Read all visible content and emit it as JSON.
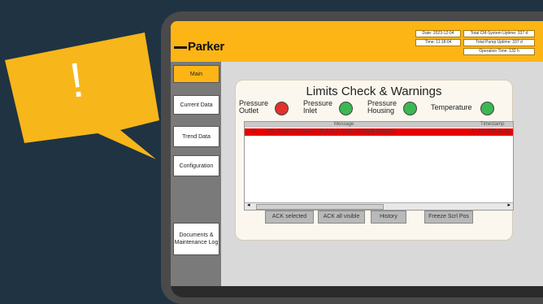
{
  "header": {
    "logo": "Parker",
    "date": "Date: 2023-12-04",
    "time": "Time: 11:18:04",
    "system_uptime": "Total CM-System Uptime: 337 d",
    "pump_uptime": "Total Pump Uptime: 337 d",
    "operation_time": "Operation Time: 132 h"
  },
  "sidebar": {
    "items": [
      {
        "label": "Main",
        "active": true
      },
      {
        "label": "Current Data"
      },
      {
        "label": "Trend Data"
      },
      {
        "label": "Configuration"
      },
      {
        "label": "Documents & Maintenance Log"
      }
    ]
  },
  "main": {
    "title": "Limits Check & Warnings",
    "sensors": [
      {
        "label_line1": "Pressure",
        "label_line2": "Outlet",
        "status_color": "#e0322b"
      },
      {
        "label_line1": "Pressure",
        "label_line2": "Inlet",
        "status_color": "#3cb754"
      },
      {
        "label_line1": "Pressure",
        "label_line2": "Housing",
        "status_color": "#3cb754"
      },
      {
        "label_line1": "Temperature",
        "label_line2": "",
        "status_color": "#3cb754"
      }
    ],
    "table": {
      "columns": [
        "",
        "Message",
        "Timestamp"
      ],
      "rows": [
        {
          "id": "0",
          "message": "The Outlet Pressure ( 0.65 bar) is below minimum pressure",
          "timestamp": "04.12.2023 11:18"
        }
      ]
    },
    "buttons": [
      "ACK selected",
      "ACK all visible",
      "History",
      "Freeze Scrl Pos"
    ]
  },
  "alert_symbol": "!",
  "colors": {
    "brand": "#fdb515",
    "alarm_row": "#e60000"
  }
}
